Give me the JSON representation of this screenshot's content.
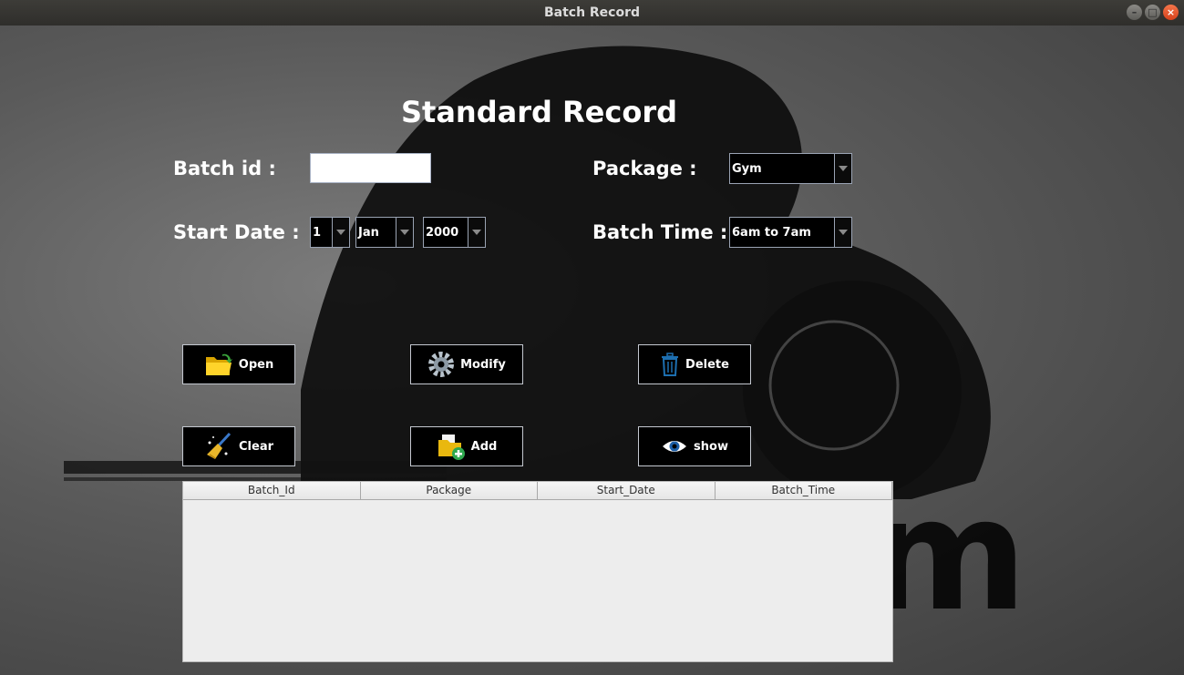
{
  "window": {
    "title": "Batch  Record",
    "controls": [
      "–",
      "□",
      "×"
    ]
  },
  "heading": "Standard Record",
  "form": {
    "batch_id_label": "Batch id :",
    "batch_id_value": "",
    "package_label": "Package :",
    "package_value": "Gym",
    "start_date_label": "Start Date :",
    "start_day": "1",
    "start_month": "Jan",
    "start_year": "2000",
    "batch_time_label": "Batch Time :",
    "batch_time_value": "6am to 7am"
  },
  "buttons": {
    "open": "Open",
    "modify": "Modify",
    "delete": "Delete",
    "clear": "Clear",
    "add": "Add",
    "show": "show"
  },
  "icons": [
    "folder-open-icon",
    "gear-icon",
    "trash-icon",
    "broom-icon",
    "folder-add-icon",
    "eye-icon"
  ],
  "table": {
    "columns": [
      "Batch_Id",
      "Package",
      "Start_Date",
      "Batch_Time"
    ],
    "rows": []
  },
  "colors": {
    "accent_text": "#ffffff",
    "control_bg": "#000000",
    "table_bg": "#ededed"
  }
}
